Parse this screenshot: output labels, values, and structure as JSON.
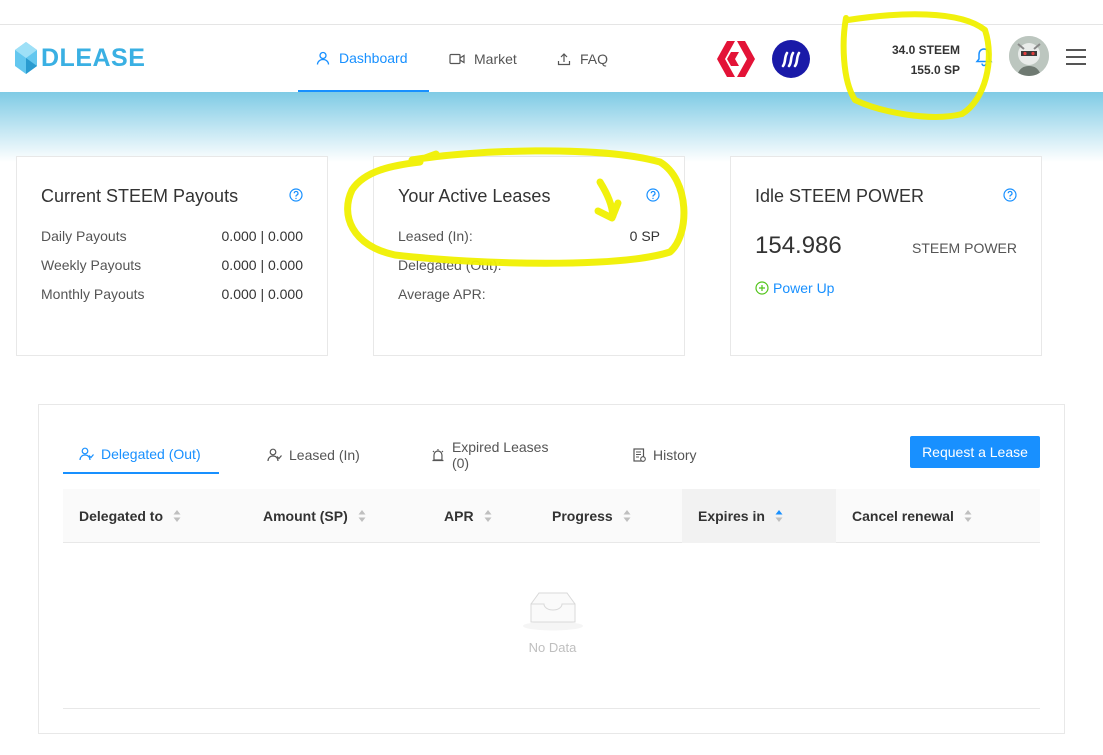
{
  "header": {
    "logo_text": "DLEASE",
    "nav": [
      {
        "label": "Dashboard",
        "icon": "user-icon",
        "active": true
      },
      {
        "label": "Market",
        "icon": "video-icon",
        "active": false
      },
      {
        "label": "FAQ",
        "icon": "upload-icon",
        "active": false
      }
    ],
    "balances": {
      "steem": "34.0 STEEM",
      "sp": "155.0 SP"
    }
  },
  "cards": {
    "payouts": {
      "title": "Current STEEM Payouts",
      "rows": [
        {
          "label": "Daily Payouts",
          "value": "0.000 | 0.000"
        },
        {
          "label": "Weekly Payouts",
          "value": "0.000 | 0.000"
        },
        {
          "label": "Monthly Payouts",
          "value": "0.000 | 0.000"
        }
      ]
    },
    "leases": {
      "title": "Your Active Leases",
      "rows": [
        {
          "label": "Leased (In):",
          "value": "0 SP"
        },
        {
          "label": "Delegated (Out):",
          "value": ""
        },
        {
          "label": "Average APR:",
          "value": ""
        }
      ]
    },
    "idle": {
      "title": "Idle STEEM POWER",
      "value": "154.986",
      "unit": "STEEM POWER",
      "power_up_label": "Power Up"
    }
  },
  "panel": {
    "tabs": [
      {
        "label": "Delegated (Out)",
        "active": true
      },
      {
        "label": "Leased (In)",
        "active": false
      },
      {
        "label": "Expired Leases (0)",
        "active": false
      },
      {
        "label": "History",
        "active": false
      }
    ],
    "request_button": "Request a Lease",
    "columns": [
      "Delegated to",
      "Amount (SP)",
      "APR",
      "Progress",
      "Expires in",
      "Cancel renewal"
    ],
    "sorted_column": "Expires in",
    "empty_text": "No Data"
  },
  "colors": {
    "accent": "#1890ff",
    "logo": "#3ab0e3",
    "hive": "#e31337",
    "steem": "#1a1aa8",
    "highlighter": "#f0f000"
  }
}
